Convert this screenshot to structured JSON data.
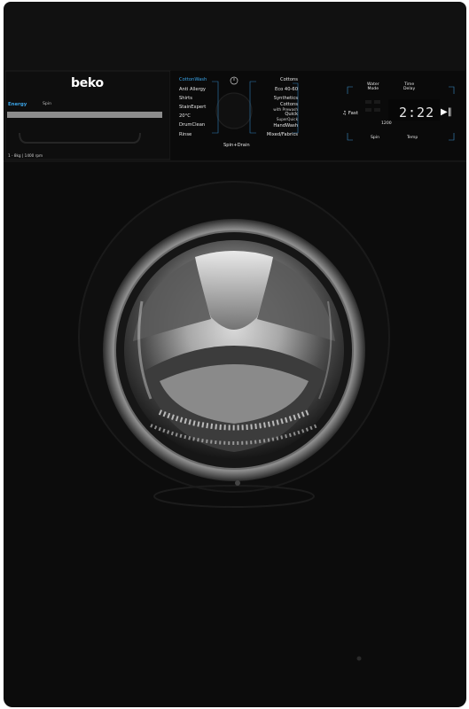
{
  "brand": {
    "logo": "beko",
    "energy_label": "Energy",
    "energy_suffix": "Spin",
    "capacity": "1 - 8kg | 1400 rpm"
  },
  "program_dial": {
    "left_programs": [
      "CottonWash",
      "Anti Allergy",
      "Shirts",
      "StainExpert",
      "20°C",
      "DrumClean",
      "Rinse"
    ],
    "right_programs": [
      "Cottons",
      "Eco 40-60",
      "Synthetics",
      "Cottons",
      "Quick",
      "HandWash",
      "Mixed/Fabrics"
    ],
    "right_sublabels": [
      "",
      "",
      "",
      "with Prewash",
      "SuperQuick",
      "",
      ""
    ],
    "bottom_label": "Spin+Drain",
    "top_icon": "power-icon"
  },
  "controls": {
    "fast_label": "Fast",
    "water_mode_label_1": "Water",
    "water_mode_label_2": "Mode",
    "time_delay_label_1": "Time",
    "time_delay_label_2": "Delay",
    "display_time": "2:22",
    "spin_value": "1200",
    "spin_label": "Spin",
    "temp_label": "Temp",
    "start_icon": "play-pause-icon"
  },
  "colors": {
    "body": "#0b0b0b",
    "accent_blue": "#3aa3e6",
    "glass": "#9a9a9a"
  }
}
